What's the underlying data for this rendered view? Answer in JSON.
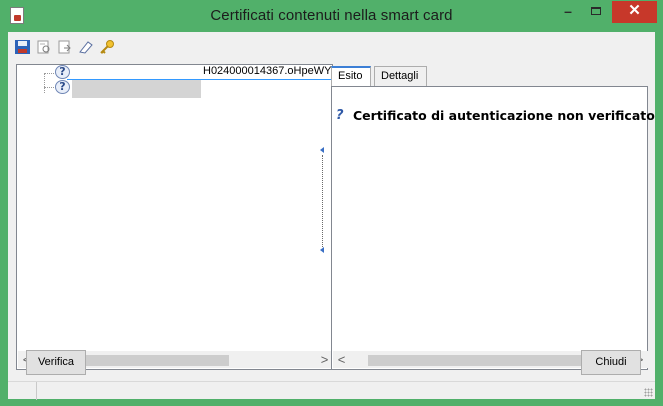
{
  "window": {
    "title": "Certificati contenuti nella smart card",
    "minimize_glyph": "–",
    "close_glyph": "✕"
  },
  "toolbar": {
    "icons": [
      "save-icon",
      "certificate-view-icon",
      "certificate-export-icon",
      "eraser-icon",
      "key-icon"
    ]
  },
  "tree": {
    "items": [
      {
        "label": "H024000014367.oHpeWY",
        "icon": "question-icon"
      },
      {
        "label": "",
        "icon": "question-icon"
      }
    ]
  },
  "tabs": [
    {
      "label": "Esito",
      "active": true
    },
    {
      "label": "Dettagli",
      "active": false
    }
  ],
  "result": {
    "icon": "?",
    "text": "Certificato di autenticazione non verificato"
  },
  "buttons": {
    "verify": "Verifica",
    "close": "Chiudi"
  },
  "scroll": {
    "left_arrow": "<",
    "right_arrow": ">"
  },
  "colors": {
    "frame": "#51b06a",
    "close_button": "#c7382a",
    "selection_line": "#3399ff"
  }
}
